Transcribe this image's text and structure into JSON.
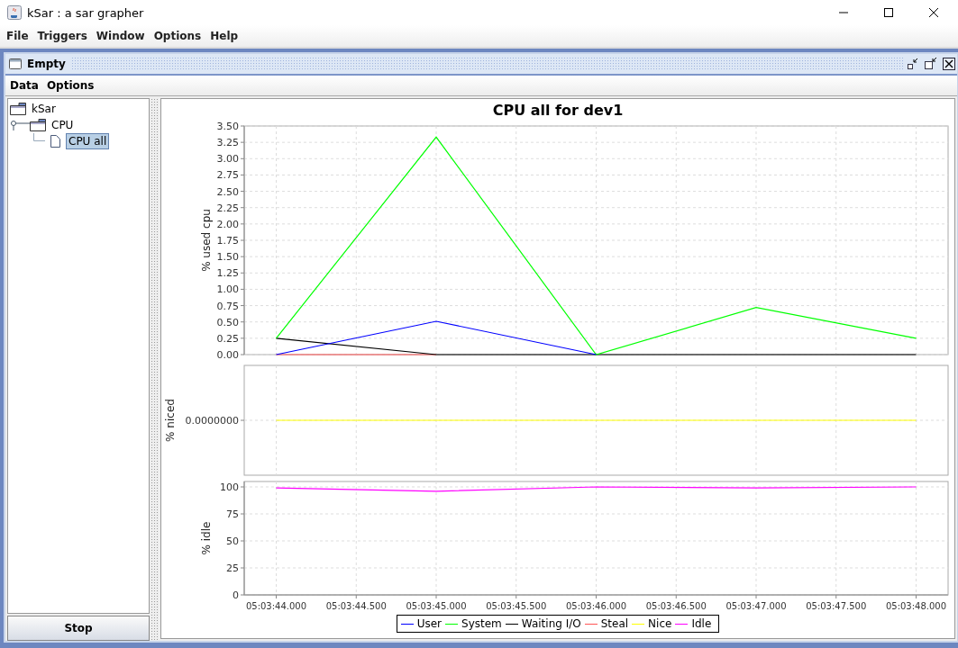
{
  "window": {
    "title": "kSar : a sar grapher"
  },
  "menu": [
    "File",
    "Triggers",
    "Window",
    "Options",
    "Help"
  ],
  "frame": {
    "title": "Empty",
    "menu": [
      "Data",
      "Options"
    ],
    "tree": [
      {
        "label": "kSar",
        "selected": false,
        "children": [
          {
            "label": "CPU",
            "selected": false,
            "expanded": true,
            "children": [
              {
                "label": "CPU all",
                "selected": true
              }
            ]
          }
        ]
      }
    ],
    "stop_button": "Stop",
    "chart": {
      "title": "CPU all for dev1",
      "plots": [
        {
          "chart_data": {
            "type": "line",
            "ylabel": "% used cpu",
            "grid": true,
            "ylim": [
              0,
              3.5
            ],
            "yticks": [
              {
                "value": 0,
                "label": "0.00"
              },
              {
                "value": 0.25,
                "label": "0.25"
              },
              {
                "value": 0.5,
                "label": "0.50"
              },
              {
                "value": 0.75,
                "label": "0.75"
              },
              {
                "value": 1,
                "label": "1.00"
              },
              {
                "value": 1.25,
                "label": "1.25"
              },
              {
                "value": 1.5,
                "label": "1.50"
              },
              {
                "value": 1.75,
                "label": "1.75"
              },
              {
                "value": 2,
                "label": "2.00"
              },
              {
                "value": 2.25,
                "label": "2.25"
              },
              {
                "value": 2.5,
                "label": "2.50"
              },
              {
                "value": 2.75,
                "label": "2.75"
              },
              {
                "value": 3,
                "label": "3.00"
              },
              {
                "value": 3.25,
                "label": "3.25"
              },
              {
                "value": 3.5,
                "label": "3.50"
              }
            ],
            "series": [
              {
                "name": "User",
                "color": "#0000ff",
                "values": [
                  0,
                  null,
                  0.51,
                  null,
                  0,
                  null,
                  null,
                  null,
                  null
                ]
              },
              {
                "name": "System",
                "color": "#00ff00",
                "values": [
                  0.25,
                  null,
                  3.33,
                  null,
                  0,
                  null,
                  0.72,
                  null,
                  0.25
                ]
              },
              {
                "name": "Waiting I/O",
                "color": "#000000",
                "values": [
                  0.25,
                  null,
                  0,
                  null,
                  0,
                  null,
                  0,
                  null,
                  0
                ]
              },
              {
                "name": "Steal",
                "color": "#ff5555",
                "values": [
                  0,
                  null,
                  0,
                  null,
                  null,
                  null,
                  null,
                  null,
                  null
                ]
              }
            ]
          }
        },
        {
          "ylabel": "% niced",
          "tick_label": "0.0000000",
          "line": {
            "name": "Nice",
            "color": "#ffff00"
          }
        },
        {
          "chart_data": {
            "type": "line",
            "ylabel": "% idle",
            "grid": true,
            "categories": [
              "05:03:44.000",
              "05:03:44.500",
              "05:03:45.000",
              "05:03:45.500",
              "05:03:46.000",
              "05:03:46.500",
              "05:03:47.000",
              "05:03:47.500",
              "05:03:48.000"
            ],
            "ylim": [
              0,
              105
            ],
            "yticks": [
              0,
              25,
              50,
              75,
              100
            ],
            "series": [
              {
                "name": "Idle",
                "color": "#ff00ff",
                "values": [
                  99,
                  null,
                  96,
                  null,
                  100,
                  null,
                  99,
                  null,
                  100
                ]
              }
            ]
          }
        }
      ]
    }
  }
}
